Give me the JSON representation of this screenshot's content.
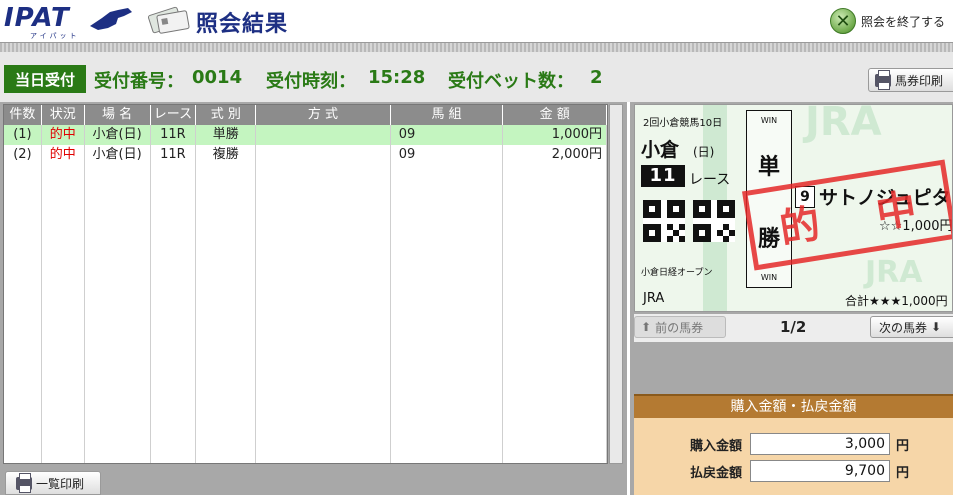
{
  "header": {
    "logo_text": "IPAT",
    "logo_sub": "アイパット",
    "page_title": "照会結果",
    "logout_label": "照会を終了する"
  },
  "infobar": {
    "today_label": "当日受付",
    "receipt_no_label": "受付番号：",
    "receipt_no": "0014",
    "receipt_time_label": "受付時刻：",
    "receipt_time": "15:28",
    "bet_count_label": "受付ベット数：",
    "bet_count": "2",
    "print_ticket_label": "馬券印刷"
  },
  "table": {
    "headers": [
      "件数",
      "状況",
      "場 名",
      "レース",
      "式 別",
      "方 式",
      "馬 組",
      "金 額"
    ],
    "rows": [
      {
        "no": "(1)",
        "status": "的中",
        "venue": "小倉(日)",
        "race": "11R",
        "type": "単勝",
        "method": "",
        "combo": "09",
        "amount": "1,000円"
      },
      {
        "no": "(2)",
        "status": "的中",
        "venue": "小倉(日)",
        "race": "11R",
        "type": "複勝",
        "method": "",
        "combo": "09",
        "amount": "2,000円"
      }
    ],
    "list_print_label": "一覧印刷"
  },
  "ticket": {
    "meet": "2回小倉競馬10日",
    "venue": "小倉",
    "day": "(日)",
    "race_no": "11",
    "race_label": "レース",
    "race_name": "小倉日経オープン",
    "org": "JRA",
    "bet_win": "WIN",
    "bet_type_1": "単",
    "bet_type_2": "勝",
    "horse_no": "9",
    "horse_name": "サトノジュピター",
    "amount": "☆☆1,000円",
    "total": "合計★★★1,000円",
    "stamp_1": "的",
    "stamp_2": "中",
    "watermark": "JRA"
  },
  "nav": {
    "prev_label": "前の馬券",
    "page": "1/2",
    "next_label": "次の馬券"
  },
  "summary": {
    "title": "購入金額・払戻金額",
    "purchase_label": "購入金額",
    "purchase_value": "3,000",
    "payout_label": "払戻金額",
    "payout_value": "9,700",
    "unit": "円"
  },
  "colors": {
    "green": "#2a7a16",
    "navy": "#1d2f83",
    "hit_red": "#e00000",
    "selected_row": "#c4f5c0",
    "summary_header": "#b47a32"
  }
}
